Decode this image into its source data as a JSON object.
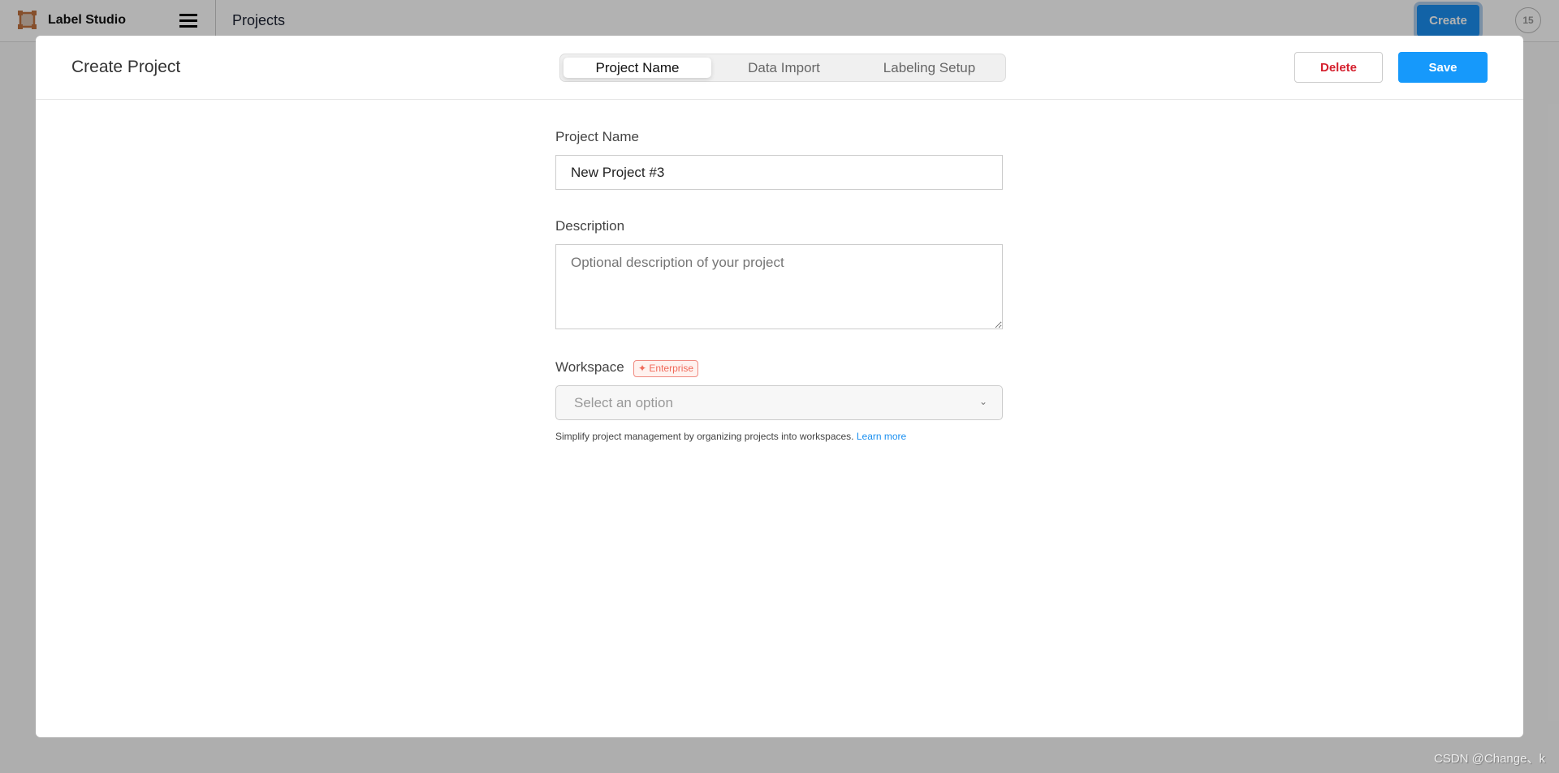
{
  "topbar": {
    "brand": "Label Studio",
    "breadcrumb": "Projects",
    "create_label": "Create",
    "notification_count": "15"
  },
  "modal": {
    "title": "Create Project",
    "tabs": [
      {
        "label": "Project Name",
        "active": true
      },
      {
        "label": "Data Import",
        "active": false
      },
      {
        "label": "Labeling Setup",
        "active": false
      }
    ],
    "delete_label": "Delete",
    "save_label": "Save",
    "form": {
      "name_label": "Project Name",
      "name_value": "New Project #3",
      "description_label": "Description",
      "description_placeholder": "Optional description of your project",
      "workspace_label": "Workspace",
      "enterprise_badge": "Enterprise",
      "workspace_placeholder": "Select an option",
      "help_text": "Simplify project management by organizing projects into workspaces.",
      "learn_more": "Learn more"
    }
  },
  "watermark": "CSDN @Change、k",
  "colors": {
    "primary": "#1699fb",
    "danger": "#d5202e",
    "enterprise": "#f06a5a"
  }
}
